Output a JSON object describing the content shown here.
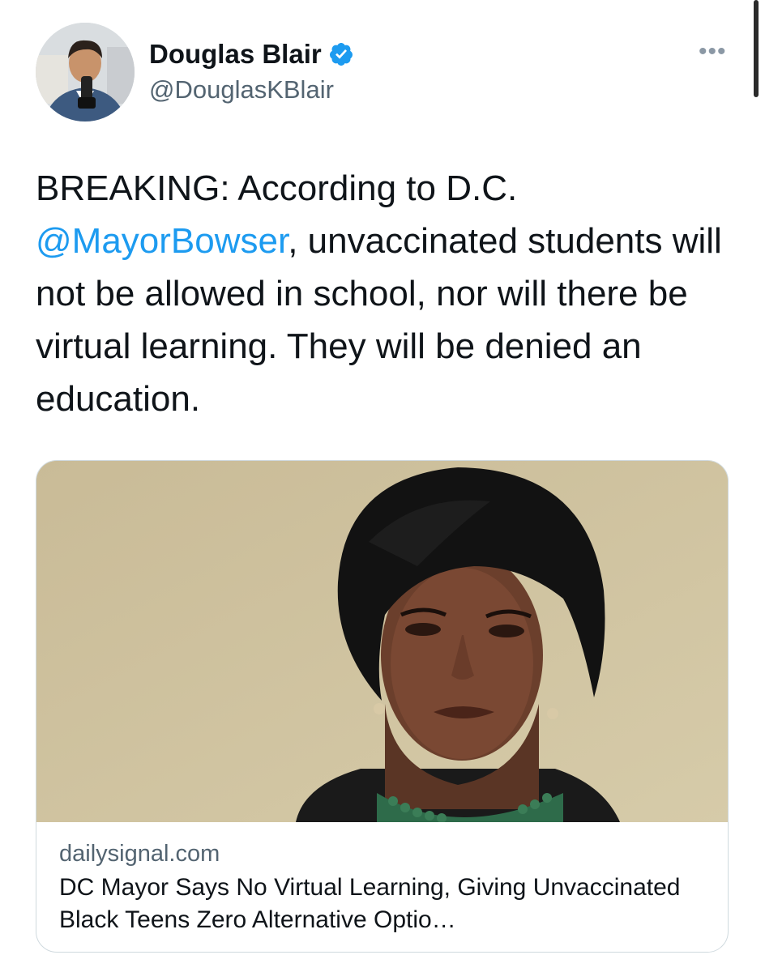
{
  "author": {
    "display_name": "Douglas Blair",
    "handle": "@DouglasKBlair",
    "verified": true,
    "verified_icon": "verified-badge-icon",
    "avatar_icon": "avatar"
  },
  "menu": {
    "more_label": "•••",
    "icon": "more-icon"
  },
  "tweet": {
    "text_before": "BREAKING: According to D.C. ",
    "mention": "@MayorBowser",
    "text_after": ", unvaccinated students will not be allowed in school, nor will there be virtual learning. They will be denied an education."
  },
  "link_card": {
    "domain": "dailysignal.com",
    "title": "DC Mayor Says No Virtual Learning, Giving Unvaccinated Black Teens Zero Alternative Optio…"
  },
  "colors": {
    "link": "#1d9bf0",
    "text": "#0f1419",
    "secondary": "#536471",
    "verified": "#1d9bf0",
    "card_border": "#cfd9de"
  }
}
